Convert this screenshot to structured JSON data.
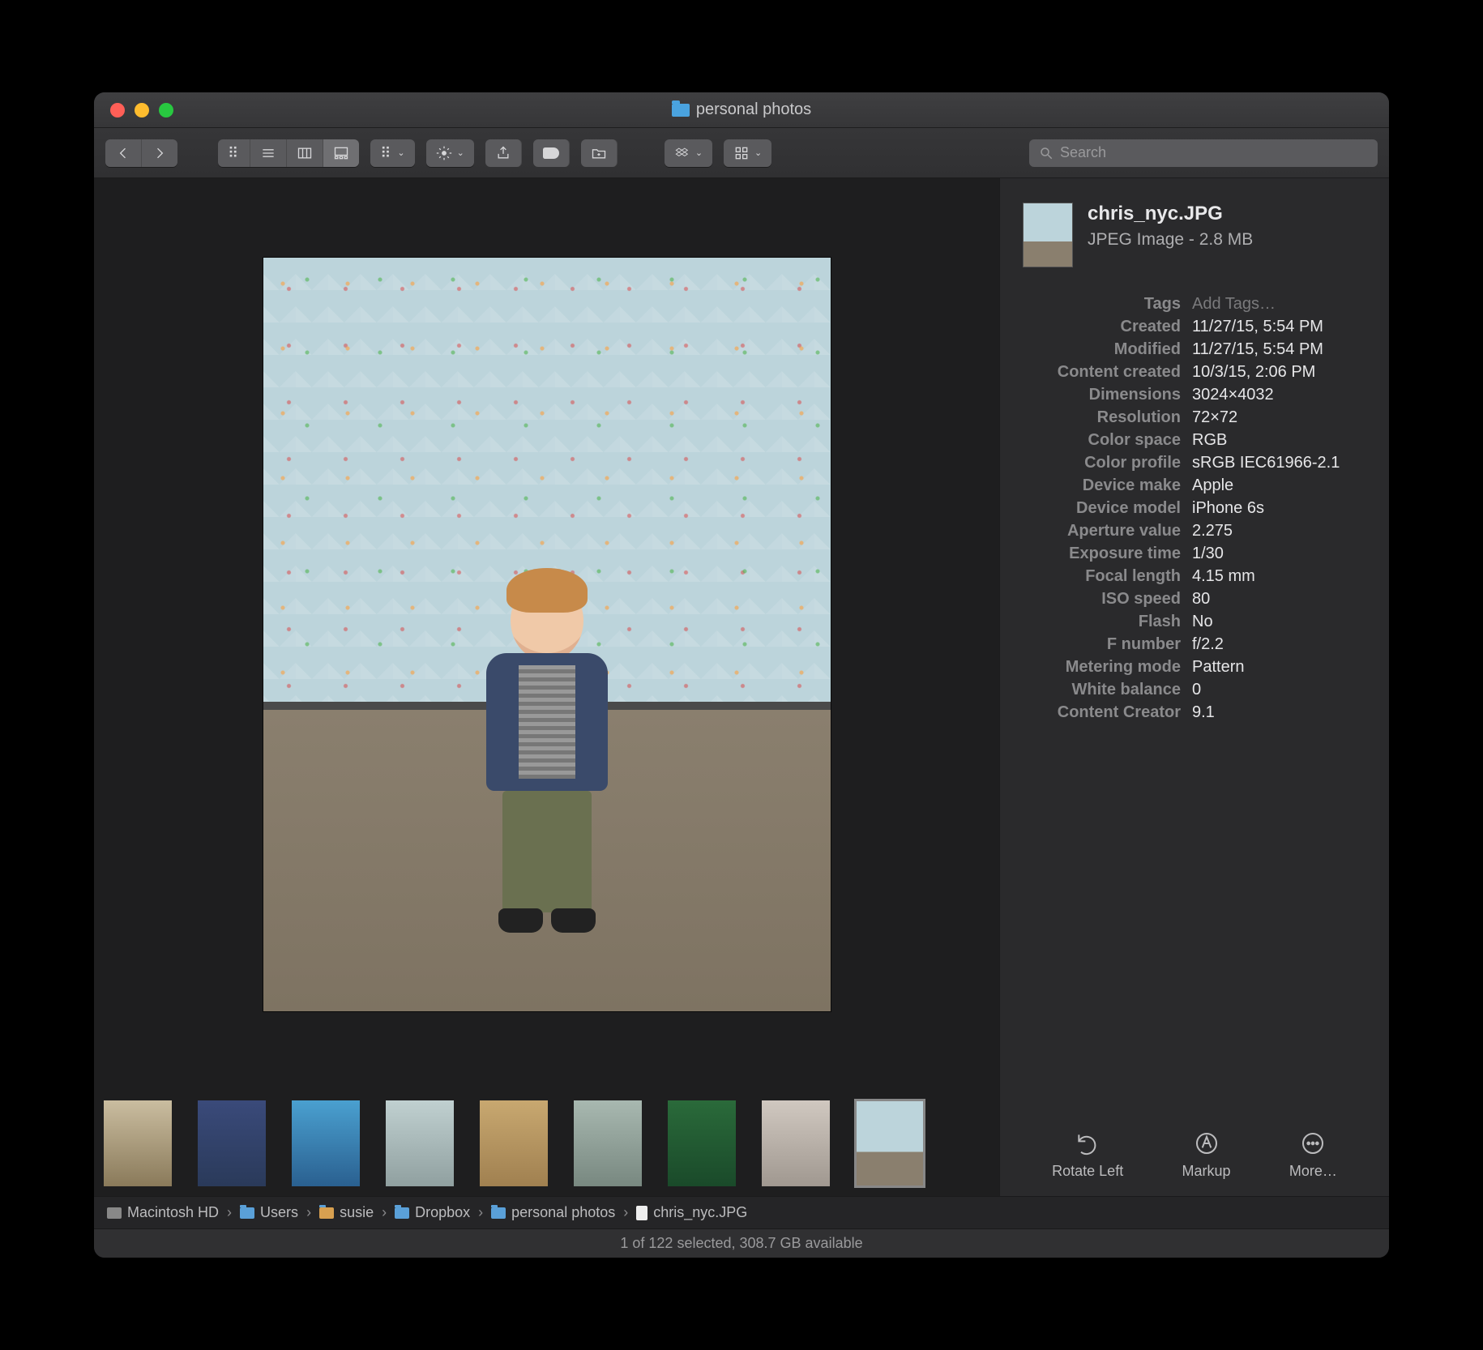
{
  "window": {
    "title": "personal photos"
  },
  "search": {
    "placeholder": "Search"
  },
  "file": {
    "name": "chris_nyc.JPG",
    "subtitle": "JPEG Image - 2.8 MB"
  },
  "metadata": {
    "tags_label": "Tags",
    "tags_placeholder": "Add Tags…",
    "created_label": "Created",
    "created": "11/27/15, 5:54 PM",
    "modified_label": "Modified",
    "modified": "11/27/15, 5:54 PM",
    "content_created_label": "Content created",
    "content_created": "10/3/15, 2:06 PM",
    "dimensions_label": "Dimensions",
    "dimensions": "3024×4032",
    "resolution_label": "Resolution",
    "resolution": "72×72",
    "color_space_label": "Color space",
    "color_space": "RGB",
    "color_profile_label": "Color profile",
    "color_profile": "sRGB IEC61966-2.1",
    "device_make_label": "Device make",
    "device_make": "Apple",
    "device_model_label": "Device model",
    "device_model": "iPhone 6s",
    "aperture_label": "Aperture value",
    "aperture": "2.275",
    "exposure_label": "Exposure time",
    "exposure": "1/30",
    "focal_label": "Focal length",
    "focal": "4.15 mm",
    "iso_label": "ISO speed",
    "iso": "80",
    "flash_label": "Flash",
    "flash": "No",
    "fnumber_label": "F number",
    "fnumber": "f/2.2",
    "metering_label": "Metering mode",
    "metering": "Pattern",
    "white_balance_label": "White balance",
    "white_balance": "0",
    "content_creator_label": "Content Creator",
    "content_creator": "9.1"
  },
  "quick_actions": {
    "rotate": "Rotate Left",
    "markup": "Markup",
    "more": "More…"
  },
  "path": {
    "hd": "Macintosh HD",
    "users": "Users",
    "user": "susie",
    "dropbox": "Dropbox",
    "folder": "personal photos",
    "file": "chris_nyc.JPG"
  },
  "status": "1 of 122 selected, 308.7 GB available",
  "thumb_colors": [
    "linear-gradient(#cabda0,#8a7a5a)",
    "linear-gradient(#3a4a7a,#2a3a5a)",
    "linear-gradient(#4aa0d0,#2a6090)",
    "linear-gradient(#c0d0d0,#90a0a0)",
    "linear-gradient(#c8a870,#a08050)",
    "linear-gradient(#a8b8b0,#788880)",
    "linear-gradient(#2a6a3a,#1a4a2a)",
    "linear-gradient(#d0c8c0,#a09890)",
    "linear-gradient(180deg,#bcd4db 0%,#bcd4db 60%,#8a7f6e 60%)"
  ]
}
